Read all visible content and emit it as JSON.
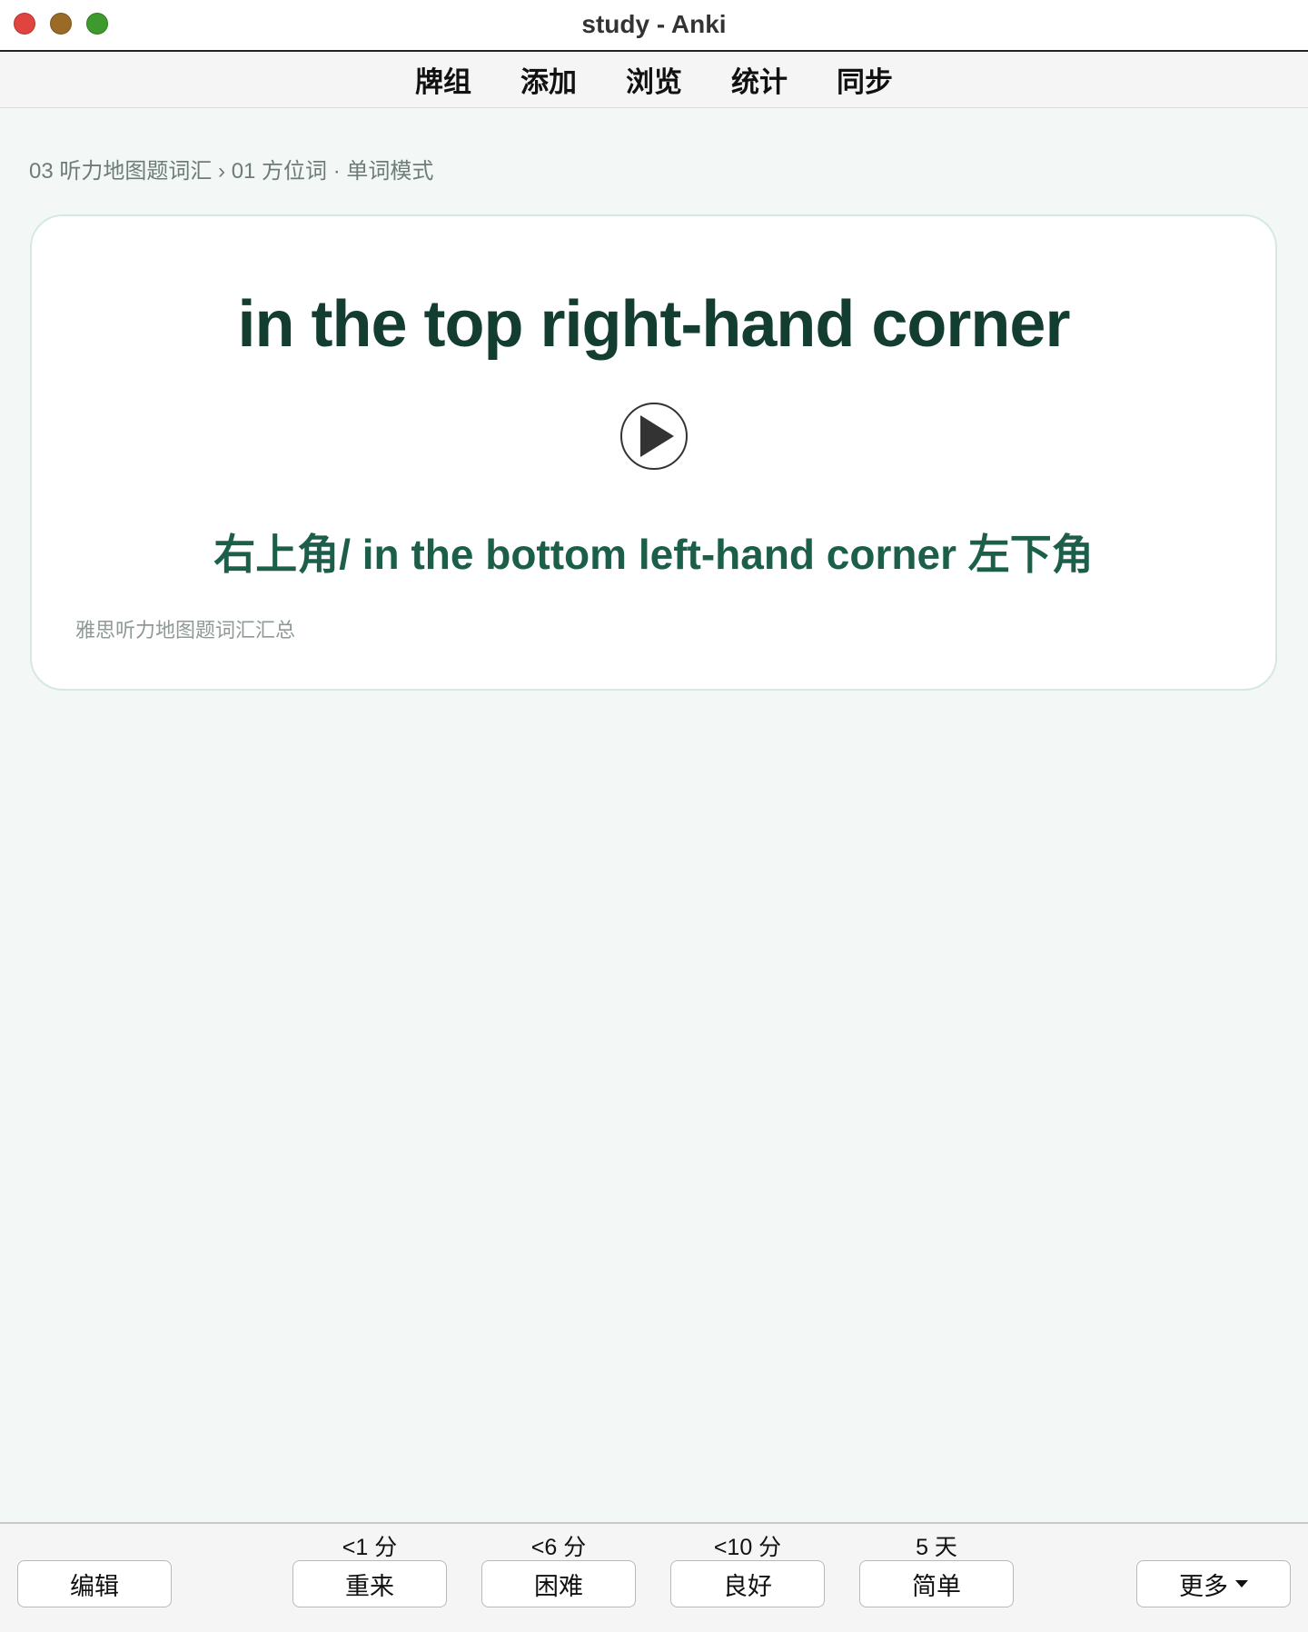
{
  "window": {
    "title": "study - Anki"
  },
  "toolbar": {
    "items": [
      "牌组",
      "添加",
      "浏览",
      "统计",
      "同步"
    ]
  },
  "breadcrumb": "03 听力地图题词汇 › 01 方位词 · 单词模式",
  "card": {
    "front": "in the top right-hand corner",
    "back": "右上角/ in the bottom left-hand corner 左下角",
    "footer": "雅思听力地图题词汇汇总",
    "play_icon": "play-icon"
  },
  "bottombar": {
    "edit_label": "编辑",
    "answers": [
      {
        "label": "重来",
        "interval": "<1 分"
      },
      {
        "label": "困难",
        "interval": "<6 分"
      },
      {
        "label": "良好",
        "interval": "<10 分"
      },
      {
        "label": "简单",
        "interval": "5 天"
      }
    ],
    "more_label": "更多"
  },
  "colors": {
    "front_text": "#143d31",
    "back_text": "#1b5f4a",
    "background": "#f3f8f6"
  }
}
